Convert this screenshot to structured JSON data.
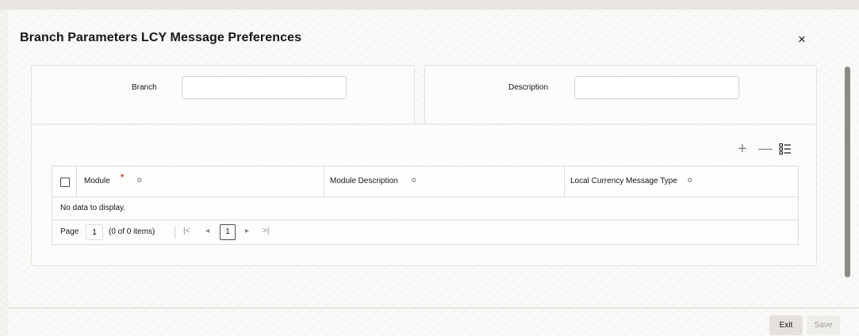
{
  "dialog": {
    "title": "Branch Parameters LCY Message Preferences",
    "close_glyph": "×"
  },
  "header_fields": {
    "branch": {
      "label": "Branch",
      "value": "",
      "placeholder": ""
    },
    "description": {
      "label": "Description",
      "value": "",
      "placeholder": ""
    }
  },
  "grid": {
    "toolbar": {
      "add_glyph": "+",
      "remove_glyph": "—",
      "settings_icon": "list-settings-icon"
    },
    "columns": [
      {
        "label": "Module",
        "required": true
      },
      {
        "label": "Module Description",
        "required": false
      },
      {
        "label": "Local Currency Message Type",
        "required": false
      }
    ],
    "required_marker": "*",
    "sort_glyph": "≎",
    "rows": [],
    "empty_text": "No data to display.",
    "pagination": {
      "page_label": "Page",
      "page_value": "1",
      "items_text": "(0 of 0 items)",
      "first_glyph": "|<",
      "prev_glyph": "◂",
      "current_page": "1",
      "next_glyph": "▸",
      "last_glyph": ">|"
    }
  },
  "footer": {
    "exit_label": "Exit",
    "save_label": "Save"
  }
}
